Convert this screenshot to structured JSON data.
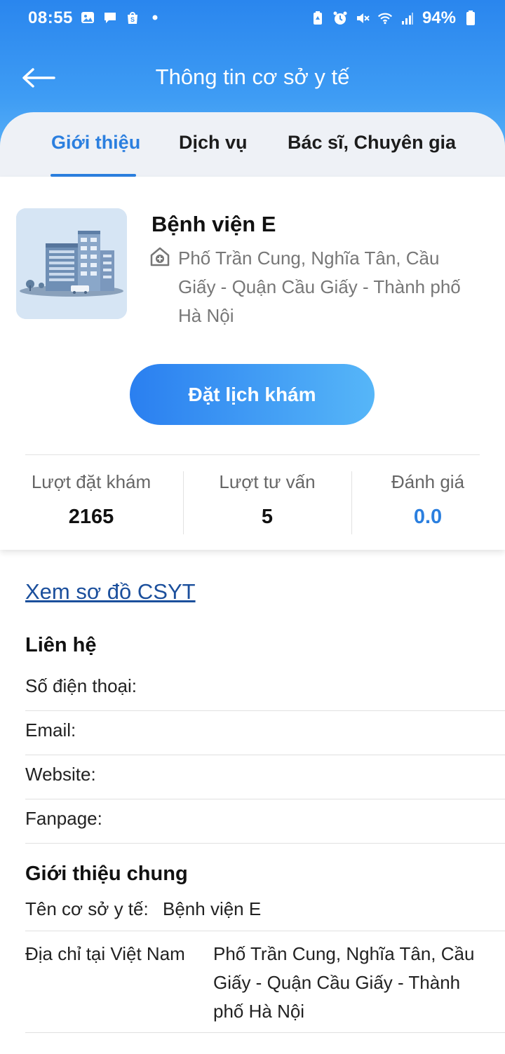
{
  "status_bar": {
    "time": "08:55",
    "battery": "94%",
    "left_icons": [
      "gallery-icon",
      "chat-icon",
      "shopee-icon",
      "dot-icon"
    ],
    "right_icons": [
      "battery-saver-icon",
      "alarm-icon",
      "mute-icon",
      "wifi-icon",
      "signal-icon",
      "battery-icon"
    ]
  },
  "header": {
    "title": "Thông tin cơ sở y tế",
    "back_icon": "arrow-left-icon"
  },
  "tabs": [
    {
      "label": "Giới thiệu",
      "active": true
    },
    {
      "label": "Dịch vụ",
      "active": false
    },
    {
      "label": "Bác sĩ, Chuyên gia",
      "active": false
    }
  ],
  "hospital": {
    "name": "Bệnh viện E",
    "address": "Phố Trần Cung, Nghĩa Tân, Cầu Giấy  - Quận Cầu Giấy - Thành phố Hà Nội",
    "address_icon": "hospital-icon",
    "image": "hospital-building-illustration"
  },
  "book_button": "Đặt lịch khám",
  "stats": [
    {
      "label": "Lượt đặt khám",
      "value": "2165"
    },
    {
      "label": "Lượt tư vấn",
      "value": "5"
    },
    {
      "label": "Đánh giá",
      "value": "0.0"
    }
  ],
  "map_link": "Xem sơ đồ CSYT",
  "contact": {
    "title": "Liên hệ",
    "rows": [
      "Số điện thoại:",
      "Email:",
      "Website:",
      "Fanpage:"
    ]
  },
  "general": {
    "title": "Giới thiệu chung",
    "rows": [
      {
        "label": "Tên cơ sở y tế:",
        "value": "Bệnh viện E"
      },
      {
        "label": "Địa chỉ tại Việt Nam",
        "value": "Phố Trần Cung, Nghĩa Tân, Cầu Giấy  - Quận Cầu Giấy - Thành phố Hà Nội"
      }
    ]
  },
  "colors": {
    "header_gradient_start": "#2a86ee",
    "accent": "#2b7fdf",
    "link": "#1b4f9c"
  }
}
